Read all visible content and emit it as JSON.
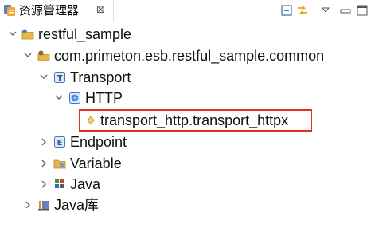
{
  "view": {
    "title": "资源管理器",
    "close_glyph": "⊠"
  },
  "toolbar": [
    {
      "name": "collapse-all-icon"
    },
    {
      "name": "link-with-editor-icon"
    },
    {
      "name": "view-menu-icon"
    },
    {
      "name": "minimize-icon"
    },
    {
      "name": "maximize-icon"
    }
  ],
  "tree": [
    {
      "label": "restful_sample",
      "icon": "project-folder-icon",
      "expanded": true
    },
    {
      "label": "com.primeton.esb.restful_sample.common",
      "icon": "module-icon",
      "expanded": true
    },
    {
      "label": "Transport",
      "icon": "transport-icon",
      "expanded": true
    },
    {
      "label": "HTTP",
      "icon": "http-globe-icon",
      "expanded": true
    },
    {
      "label": "transport_http.transport_httpx",
      "icon": "transport-item-icon",
      "highlighted": true
    },
    {
      "label": "Endpoint",
      "icon": "endpoint-icon",
      "expanded": false
    },
    {
      "label": "Variable",
      "icon": "variable-folder-icon",
      "expanded": false
    },
    {
      "label": "Java",
      "icon": "java-icon",
      "expanded": false
    },
    {
      "label": "Java库",
      "icon": "java-library-icon",
      "expanded": false
    }
  ],
  "colors": {
    "highlight_border": "#e0302b",
    "twisty": "#666666"
  }
}
